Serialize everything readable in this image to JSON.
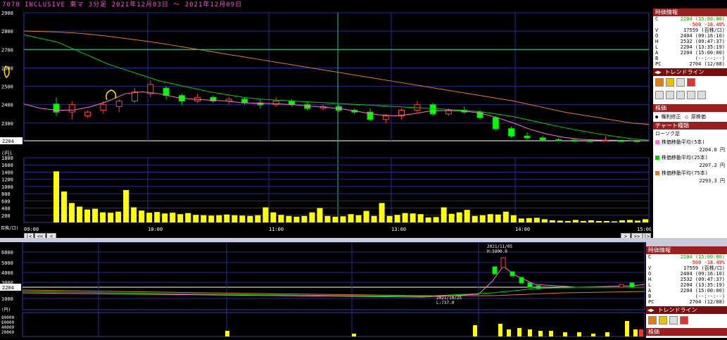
{
  "title": "7078 INCLUSIVE 東マ 3分足 2021年12月03日 ～ 2021年12月09日",
  "price_axis": [
    "2900",
    "2800",
    "2700",
    "2600",
    "2500",
    "2400",
    "2300",
    "2204"
  ],
  "volume_axis_unit": "(円)",
  "volume_axis": [
    "1800",
    "1600",
    "1400",
    "1200",
    "1000",
    "800",
    "600",
    "400",
    "200"
  ],
  "volume_unit": "百株/口)",
  "time_axis": [
    "09:00",
    "10:00",
    "11:00",
    "13:00",
    "14:00",
    "15:00"
  ],
  "nav_left": [
    "|<",
    "<<",
    "<"
  ],
  "nav_right": [
    ">",
    ">>",
    "|>"
  ],
  "quote_panel": {
    "title": "時価情報",
    "rows": [
      {
        "k": "C",
        "v": "2204 (15:00:00)"
      },
      {
        "k": "",
        "v": "-500 -18.49%"
      },
      {
        "k": "V",
        "v": "17559 (百株/口)"
      },
      {
        "k": "O",
        "v": "2404 (09:16:10)"
      },
      {
        "k": "H",
        "v": "2532 (09:47:37)"
      },
      {
        "k": "L",
        "v": "2204 (13:35:19)"
      },
      {
        "k": "A",
        "v": "2204 (15:00:00)"
      },
      {
        "k": "B",
        "v": "(--:--:--)"
      },
      {
        "k": "PC",
        "v": "2704 (12/08)"
      }
    ]
  },
  "trendline_label": "トレンドライン",
  "stock_price_label": "株価",
  "radio_options": [
    "権利修正",
    "原株価"
  ],
  "chart_type_label": "チャート種類",
  "candle_label": "ローソク足",
  "legend": [
    {
      "label": "株価移動平均(5本)",
      "value": "2204.0 円",
      "color": "#ff6fd0"
    },
    {
      "label": "株価移動平均(25本)",
      "value": "2207.2 円",
      "color": "#00d000"
    },
    {
      "label": "株価移動平均(75本)",
      "value": "2293.3 円",
      "color": "#e07a2a"
    }
  ],
  "panel2": {
    "title": "時価情報",
    "rows": [
      {
        "k": "C",
        "v": "2204 (15:00:00)"
      },
      {
        "k": "",
        "v": "-500 -18.49%"
      },
      {
        "k": "V",
        "v": "17559 (百株/口)"
      },
      {
        "k": "O",
        "v": "2404 (09:16:10)"
      },
      {
        "k": "H",
        "v": "2532 (09:47:37)"
      },
      {
        "k": "L",
        "v": "2204 (13:35:19)"
      },
      {
        "k": "A",
        "v": "2204 (15:00:00)"
      },
      {
        "k": "B",
        "v": "(--:--:--)"
      },
      {
        "k": "PC",
        "v": "2704 (12/08)"
      }
    ],
    "trendline_label": "トレンドライン",
    "footer": "株価"
  },
  "chart2": {
    "price_axis": [
      "6000",
      "5000",
      "4000",
      "3000",
      "2204",
      "1000"
    ],
    "volume_unit": "(円)",
    "volume_axis": [
      "80000",
      "60000",
      "40000",
      "20000"
    ],
    "high_annotation": "2021/11/05",
    "high_value": "H:5900.0",
    "low_annotation": "2021/10/25",
    "low_value": "L:737.0"
  },
  "chart_data": {
    "type": "candlestick",
    "title": "7078 INCLUSIVE 東マ 3分足 2021年12月03日 ～ 2021年12月09日",
    "ylim": [
      2204,
      2900
    ],
    "current_price": 2204,
    "crosshair_price": 2700,
    "candles": [
      {
        "o": 2404,
        "h": 2440,
        "l": 2340,
        "c": 2360
      },
      {
        "o": 2360,
        "h": 2420,
        "l": 2320,
        "c": 2400
      },
      {
        "o": 2340,
        "h": 2370,
        "l": 2330,
        "c": 2360
      },
      {
        "o": 2370,
        "h": 2420,
        "l": 2350,
        "c": 2400
      },
      {
        "o": 2390,
        "h": 2430,
        "l": 2360,
        "c": 2420
      },
      {
        "o": 2420,
        "h": 2490,
        "l": 2410,
        "c": 2470
      },
      {
        "o": 2460,
        "h": 2532,
        "l": 2440,
        "c": 2510
      },
      {
        "o": 2490,
        "h": 2500,
        "l": 2430,
        "c": 2450
      },
      {
        "o": 2450,
        "h": 2460,
        "l": 2400,
        "c": 2420
      },
      {
        "o": 2420,
        "h": 2460,
        "l": 2410,
        "c": 2440
      },
      {
        "o": 2440,
        "h": 2450,
        "l": 2410,
        "c": 2420
      },
      {
        "o": 2420,
        "h": 2440,
        "l": 2400,
        "c": 2430
      },
      {
        "o": 2430,
        "h": 2440,
        "l": 2400,
        "c": 2410
      },
      {
        "o": 2410,
        "h": 2430,
        "l": 2380,
        "c": 2400
      },
      {
        "o": 2400,
        "h": 2440,
        "l": 2390,
        "c": 2420
      },
      {
        "o": 2420,
        "h": 2430,
        "l": 2390,
        "c": 2400
      },
      {
        "o": 2400,
        "h": 2410,
        "l": 2370,
        "c": 2380
      },
      {
        "o": 2380,
        "h": 2400,
        "l": 2370,
        "c": 2390
      },
      {
        "o": 2390,
        "h": 2400,
        "l": 2360,
        "c": 2370
      },
      {
        "o": 2370,
        "h": 2380,
        "l": 2350,
        "c": 2360
      },
      {
        "o": 2360,
        "h": 2380,
        "l": 2310,
        "c": 2320
      },
      {
        "o": 2320,
        "h": 2350,
        "l": 2300,
        "c": 2340
      },
      {
        "o": 2340,
        "h": 2380,
        "l": 2320,
        "c": 2370
      },
      {
        "o": 2370,
        "h": 2420,
        "l": 2360,
        "c": 2400
      },
      {
        "o": 2400,
        "h": 2410,
        "l": 2340,
        "c": 2350
      },
      {
        "o": 2350,
        "h": 2380,
        "l": 2340,
        "c": 2370
      },
      {
        "o": 2370,
        "h": 2390,
        "l": 2350,
        "c": 2360
      },
      {
        "o": 2360,
        "h": 2370,
        "l": 2320,
        "c": 2330
      },
      {
        "o": 2330,
        "h": 2340,
        "l": 2260,
        "c": 2270
      },
      {
        "o": 2270,
        "h": 2280,
        "l": 2220,
        "c": 2230
      },
      {
        "o": 2230,
        "h": 2250,
        "l": 2210,
        "c": 2220
      },
      {
        "o": 2220,
        "h": 2230,
        "l": 2205,
        "c": 2210
      },
      {
        "o": 2210,
        "h": 2220,
        "l": 2204,
        "c": 2208
      },
      {
        "o": 2208,
        "h": 2215,
        "l": 2204,
        "c": 2206
      },
      {
        "o": 2206,
        "h": 2212,
        "l": 2204,
        "c": 2205
      },
      {
        "o": 2205,
        "h": 2230,
        "l": 2204,
        "c": 2206
      },
      {
        "o": 2206,
        "h": 2210,
        "l": 2204,
        "c": 2205
      },
      {
        "o": 2205,
        "h": 2208,
        "l": 2204,
        "c": 2204
      }
    ],
    "ma5": [
      2404,
      2380,
      2370,
      2372,
      2390,
      2420,
      2460,
      2470,
      2460,
      2440,
      2430,
      2425,
      2420,
      2410,
      2408,
      2405,
      2400,
      2392,
      2385,
      2375,
      2360,
      2345,
      2340,
      2350,
      2365,
      2368,
      2366,
      2355,
      2330,
      2300,
      2265,
      2240,
      2222,
      2212,
      2208,
      2207,
      2205,
      2204
    ],
    "ma25": [
      2780,
      2760,
      2740,
      2700,
      2660,
      2620,
      2590,
      2560,
      2530,
      2510,
      2490,
      2470,
      2455,
      2440,
      2430,
      2425,
      2420,
      2415,
      2410,
      2405,
      2400,
      2395,
      2390,
      2385,
      2380,
      2375,
      2370,
      2362,
      2350,
      2335,
      2315,
      2295,
      2275,
      2258,
      2242,
      2228,
      2215,
      2207
    ],
    "ma75": [
      2800,
      2798,
      2795,
      2790,
      2782,
      2772,
      2760,
      2748,
      2735,
      2720,
      2705,
      2690,
      2675,
      2660,
      2645,
      2630,
      2615,
      2600,
      2585,
      2570,
      2555,
      2540,
      2525,
      2510,
      2495,
      2480,
      2465,
      2450,
      2435,
      2420,
      2400,
      2380,
      2360,
      2345,
      2330,
      2315,
      2300,
      2293
    ],
    "volumes": [
      1420,
      860,
      540,
      440,
      360,
      380,
      280,
      270,
      300,
      900,
      420,
      330,
      270,
      290,
      250,
      270,
      230,
      260,
      210,
      200,
      190,
      200,
      220,
      200,
      190,
      180,
      200,
      420,
      280,
      210,
      180,
      160,
      180,
      280,
      400,
      180,
      160,
      170,
      230,
      200,
      320,
      180,
      540,
      180,
      210,
      260,
      250,
      230,
      140,
      150,
      420,
      240,
      280,
      350,
      180,
      200,
      230,
      220,
      300,
      200,
      110,
      120,
      130,
      90,
      60,
      50,
      40,
      70,
      40,
      60,
      40,
      40,
      30,
      60,
      70,
      50,
      90
    ]
  }
}
